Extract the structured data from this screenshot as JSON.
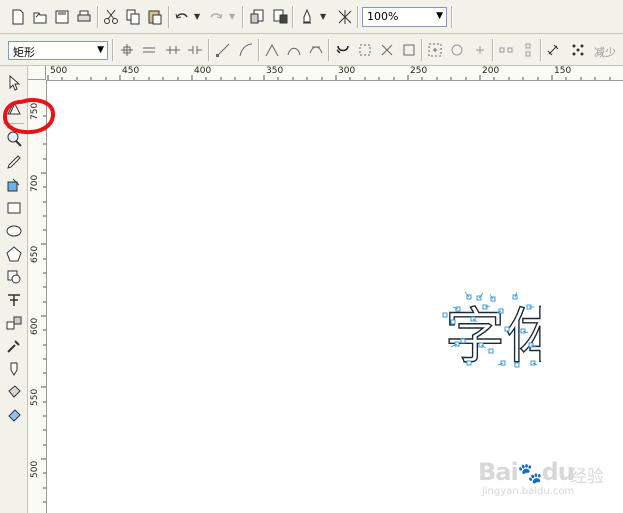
{
  "toolbar": {
    "zoom_value": "100%",
    "icons": [
      "new-icon",
      "open-icon",
      "save-icon",
      "print-icon",
      "cut-icon",
      "copy-icon",
      "paste-icon",
      "undo-icon",
      "redo-icon",
      "import-icon",
      "export-icon",
      "launcher-icon",
      "snap-icon"
    ]
  },
  "property_bar": {
    "shape_type": "矩形",
    "trailing_label": "减少"
  },
  "toolbox": {
    "tools": [
      "pick-tool",
      "shape-tool",
      "zoom-tool",
      "freehand-tool",
      "smart-fill-tool",
      "rectangle-tool",
      "ellipse-tool",
      "polygon-tool",
      "basic-shapes-tool",
      "text-tool",
      "interactive-blend-tool",
      "eyedropper-tool",
      "outline-tool",
      "fill-tool",
      "interactive-fill-tool"
    ]
  },
  "ruler": {
    "horizontal_labels": [
      "500",
      "450",
      "400",
      "350",
      "300",
      "250",
      "200",
      "150"
    ],
    "vertical_labels": [
      "750",
      "700",
      "650",
      "600",
      "550",
      "500"
    ]
  },
  "canvas": {
    "traced_text": "字体"
  },
  "watermark": {
    "brand": "Bai",
    "brand2": "du",
    "cn": "经验",
    "url": "jingyan.baidu.com"
  },
  "colors": {
    "highlight": "#e8131a",
    "node": "#2a8fd6"
  }
}
